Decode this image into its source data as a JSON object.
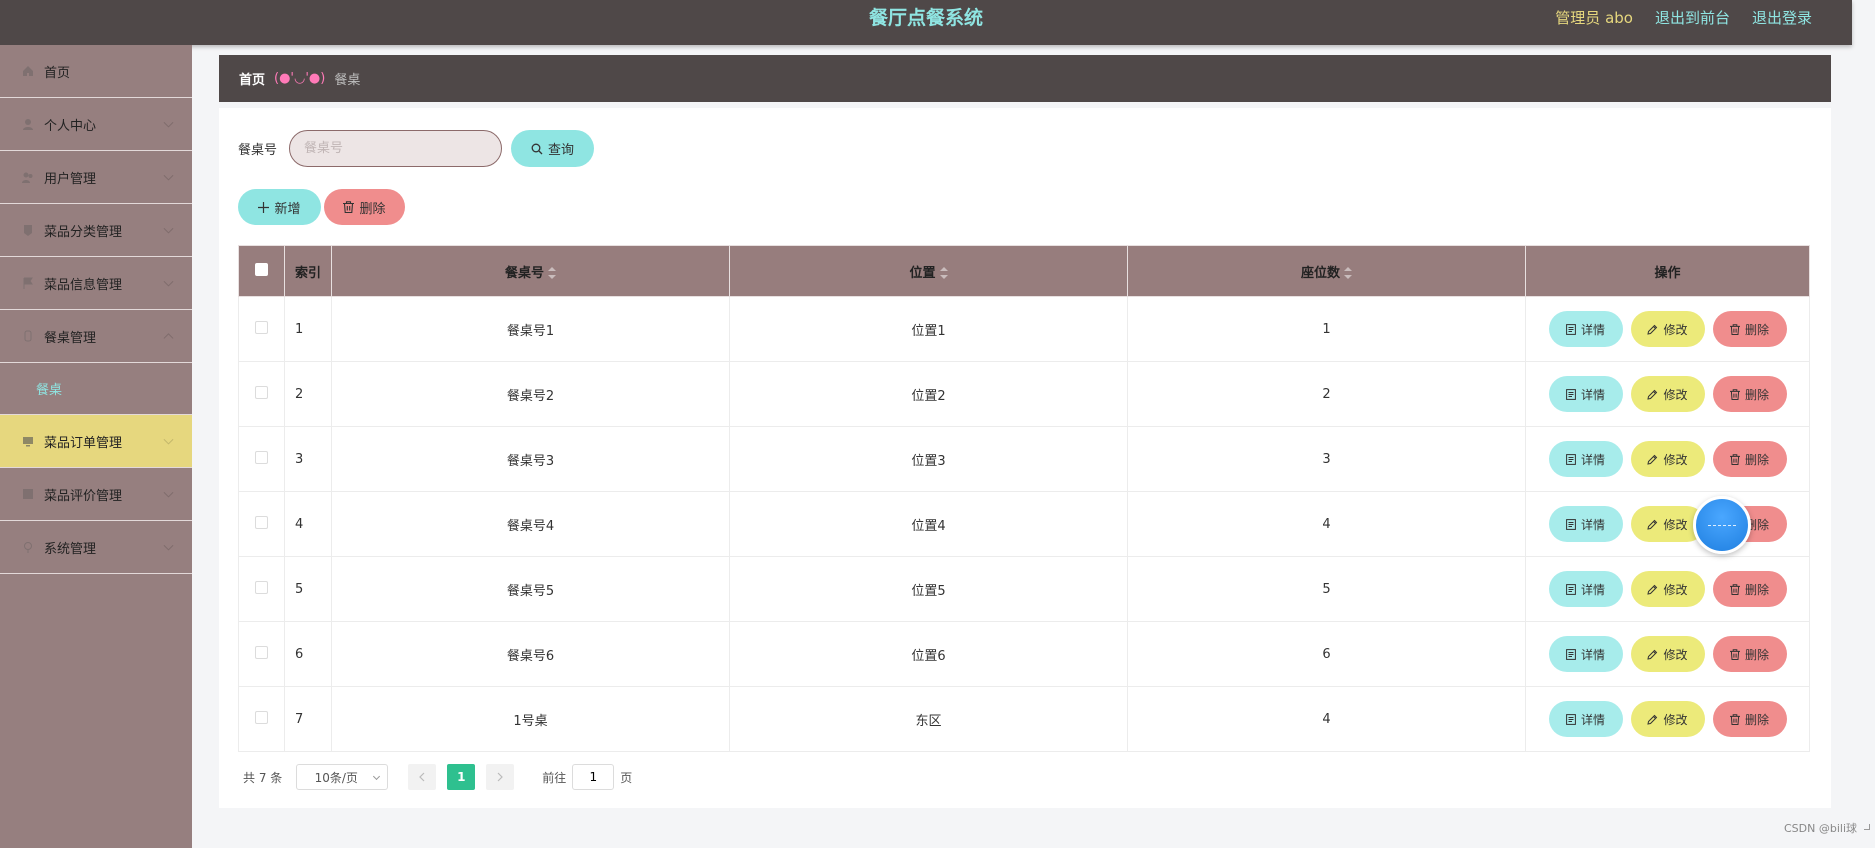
{
  "header": {
    "title": "餐厅点餐系统",
    "admin_label": "管理员 abo",
    "to_front": "退出到前台",
    "logout": "退出登录"
  },
  "sidebar": {
    "items": [
      {
        "label": "首页",
        "icon": "home-icon"
      },
      {
        "label": "个人中心",
        "icon": "user-icon"
      },
      {
        "label": "用户管理",
        "icon": "users-icon"
      },
      {
        "label": "菜品分类管理",
        "icon": "category-icon"
      },
      {
        "label": "菜品信息管理",
        "icon": "flag-icon"
      },
      {
        "label": "餐桌管理",
        "icon": "table-icon"
      },
      {
        "label": "菜品订单管理",
        "icon": "monitor-icon"
      },
      {
        "label": "菜品评价管理",
        "icon": "comment-icon"
      },
      {
        "label": "系统管理",
        "icon": "settings-icon"
      }
    ],
    "sub_item": "餐桌",
    "active_color": "#e6d77e"
  },
  "breadcrumb": {
    "home": "首页",
    "separator": "(●'◡'●)",
    "current": "餐桌"
  },
  "search": {
    "label": "餐桌号",
    "placeholder": "餐桌号",
    "query_label": "查询"
  },
  "actions": {
    "add_label": "新增",
    "delete_label": "删除"
  },
  "table": {
    "columns": {
      "index": "索引",
      "table_no": "餐桌号",
      "position": "位置",
      "seats": "座位数",
      "ops": "操作"
    },
    "op_labels": {
      "detail": "详情",
      "edit": "修改",
      "remove": "删除"
    },
    "rows": [
      {
        "index": "1",
        "table_no": "餐桌号1",
        "position": "位置1",
        "seats": "1"
      },
      {
        "index": "2",
        "table_no": "餐桌号2",
        "position": "位置2",
        "seats": "2"
      },
      {
        "index": "3",
        "table_no": "餐桌号3",
        "position": "位置3",
        "seats": "3"
      },
      {
        "index": "4",
        "table_no": "餐桌号4",
        "position": "位置4",
        "seats": "4"
      },
      {
        "index": "5",
        "table_no": "餐桌号5",
        "position": "位置5",
        "seats": "5"
      },
      {
        "index": "6",
        "table_no": "餐桌号6",
        "position": "位置6",
        "seats": "6"
      },
      {
        "index": "7",
        "table_no": "1号桌",
        "position": "东区",
        "seats": "4"
      }
    ]
  },
  "pagination": {
    "total": "共 7 条",
    "page_size": "10条/页",
    "current_page": "1",
    "goto_prefix": "前往",
    "goto_value": "1",
    "goto_suffix": "页"
  },
  "watermark": "CSDN @bili球",
  "colors": {
    "header_bg": "#4f4848",
    "sidebar_bg": "#967f7f",
    "accent_cyan": "#8fe5e2",
    "accent_yellow": "#ecea7a",
    "accent_red": "#f08d8d",
    "page_active": "#2ec08f"
  }
}
